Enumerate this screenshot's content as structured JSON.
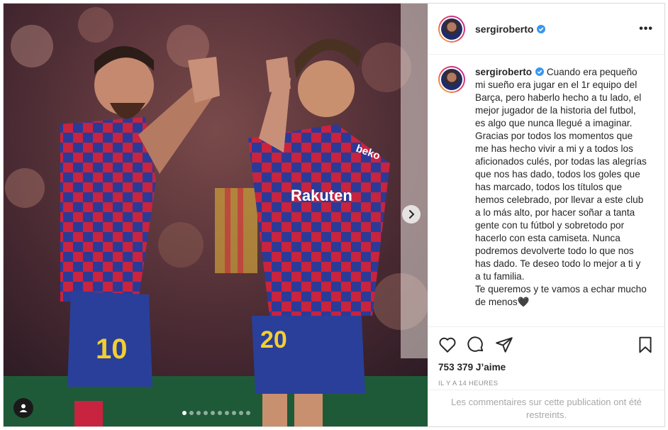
{
  "post": {
    "username": "sergiroberto",
    "caption": "Cuando era pequeño mi sueño era jugar en el 1r equipo del Barça, pero haberlo hecho a tu lado, el mejor jugador de la historia del futbol, es algo que nunca llegué a imaginar. Gracias por todos los momentos que me has hecho vivir a mi y a todos los aficionados culés, por todas las alegrías que nos has dado, todos los goles que has marcado, todos los títulos que hemos celebrado, por llevar a este club a lo más alto, por hacer soñar a tanta gente con tu fútbol y sobretodo por hacerlo con esta camiseta. Nunca podremos devolverte todo lo que nos has dado. Te deseo todo lo mejor a ti y a tu familia.\nTe queremos y te vamos a echar mucho de menos🖤",
    "likes": "753 379 J’aime",
    "time": "IL Y A 14 HEURES",
    "comments_restricted": "Les commentaires sur cette publication ont été restreints.",
    "carousel_dots": 10,
    "carousel_active_index": 0
  },
  "image": {
    "jersey_sponsor": "Rakuten",
    "jersey_number_left": "10",
    "jersey_number_right": "20",
    "sleeve_sponsor": "beko"
  },
  "icons": [
    "verified-badge-icon",
    "more-options-icon",
    "heart-icon",
    "comment-icon",
    "share-icon",
    "bookmark-icon",
    "chevron-right-icon",
    "user-tag-icon"
  ],
  "colors": {
    "verified": "#3897f0",
    "border": "#dbdbdb",
    "secondary_text": "#8e8e8e"
  }
}
